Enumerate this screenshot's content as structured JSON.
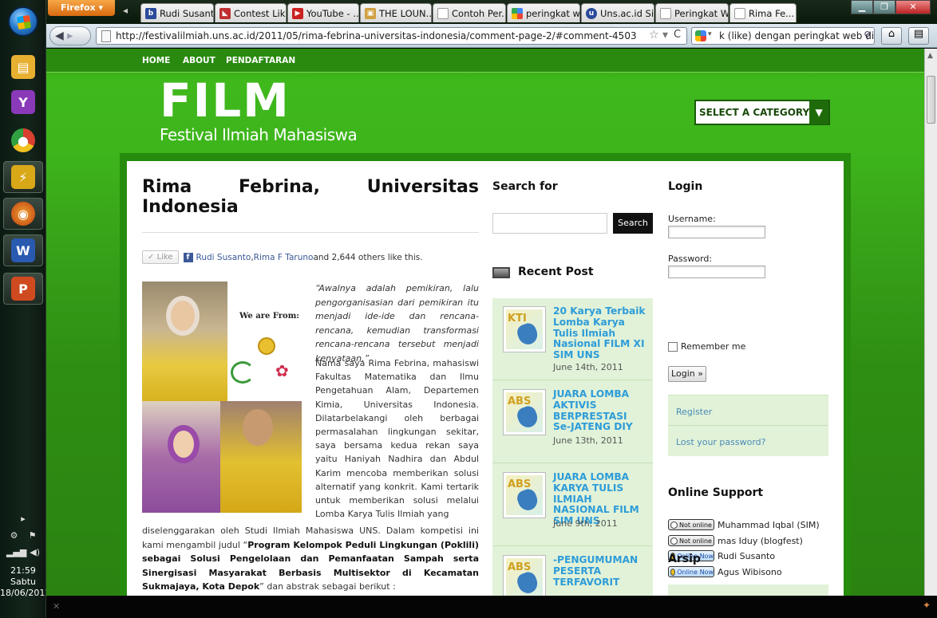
{
  "taskbar": {
    "items": [
      {
        "name": "explorer-icon",
        "color": "#e8b030"
      },
      {
        "name": "yahoo-messenger-icon",
        "color": "#8a3ab8"
      },
      {
        "name": "chrome-icon",
        "color": "#d84030"
      },
      {
        "name": "winamp-icon",
        "color": "#d8a818"
      },
      {
        "name": "firefox-icon",
        "color": "#e06a18"
      },
      {
        "name": "word-icon",
        "color": "#2a5ab0"
      },
      {
        "name": "powerpoint-icon",
        "color": "#d04a20"
      }
    ],
    "tray": {
      "time": "21:59",
      "day": "Sabtu",
      "date": "18/06/2011"
    }
  },
  "browser": {
    "firefox_menu": "Firefox",
    "tabs": [
      {
        "label": "Rudi Susanto",
        "icon": "blog-icon",
        "color": "#2a4a9a"
      },
      {
        "label": "Contest Lik...",
        "icon": "contest-icon",
        "color": "#c03030"
      },
      {
        "label": "YouTube - ...",
        "icon": "youtube-icon",
        "color": "#cc2020"
      },
      {
        "label": "THE LOUN...",
        "icon": "lounge-icon",
        "color": "#d0a040"
      },
      {
        "label": "Contoh Per...",
        "icon": "page-icon",
        "color": "#888888"
      },
      {
        "label": "peringkat w...",
        "icon": "google-icon",
        "color": "#4285f4"
      },
      {
        "label": "Uns.ac.id Sit...",
        "icon": "uns-icon",
        "color": "#2a4a9a"
      },
      {
        "label": "Peringkat W...",
        "icon": "page-icon",
        "color": "#888888"
      },
      {
        "label": "Rima Fe...",
        "icon": "page-icon",
        "color": "#888888",
        "active": true
      }
    ],
    "url": "http://festivalilmiah.uns.ac.id/2011/05/rima-febrina-universitas-indonesia/comment-page-2/#comment-4503",
    "search_text": "k (like) dengan peringkat web di alexa"
  },
  "site": {
    "nav": [
      "HOME",
      "ABOUT",
      "PENDAFTARAN"
    ],
    "logo_title": "FILM",
    "logo_subtitle": "Festival Ilmiah Mahasiswa",
    "category_select": "SELECT A CATEGORY"
  },
  "post": {
    "title_line1_words": [
      "Rima",
      "Febrina,",
      "Universitas"
    ],
    "title_line2": "Indonesia",
    "like": {
      "button": "Like",
      "friend1": "Rudi Susanto",
      "sep": ", ",
      "friend2": "Rima F Taruno",
      "others": " and 2,644 others like this."
    },
    "photo_caption": "We are From:",
    "quote": "“Awalnya adalah pemikiran, lalu pengorganisasian dari pemikiran itu menjadi ide-ide dan rencana-rencana, kemudian transformasi rencana-rencana tersebut menjadi kenyataan.”",
    "body1": "Nama saya Rima Febrina, mahasiswi Fakultas Matematika dan Ilmu Pengetahuan Alam, Departemen Kimia, Universitas Indonesia. Dilatarbelakangi oleh berbagai permasalahan lingkungan sekitar, saya bersama kedua rekan saya yaitu Haniyah Nadhira dan Abdul Karim mencoba memberikan solusi alternatif yang konkrit. Kami tertarik untuk memberikan solusi melalui Lomba Karya Tulis Ilmiah yang",
    "body2_pre": "diselenggarakan oleh Studi Ilmiah Mahasiswa UNS. Dalam kompetisi ini kami mengambil judul “",
    "body2_bold": "Program Kelompok Peduli Lingkungan (Poklili) sebagai Solusi Pengelolaan dan Pemanfaatan Sampah serta Sinergisasi Masyarakat Berbasis Multisektor di Kecamatan Sukmajaya, Kota Depok",
    "body2_post": "” dan abstrak sebagai berikut :"
  },
  "sidebar_mid": {
    "search_title": "Search for",
    "search_button": "Search",
    "recent_title": "Recent Post",
    "recent_posts": [
      {
        "thumb": "KTI",
        "title": "20 Karya Terbaik Lomba Karya Tulis Ilmiah Nasional FILM XI SIM UNS",
        "date": "June 14th, 2011"
      },
      {
        "thumb": "ABS",
        "title": "JUARA LOMBA AKTIVIS BERPRESTASI Se-JATENG DIY",
        "date": "June 13th, 2011"
      },
      {
        "thumb": "ABS",
        "title": "JUARA LOMBA KARYA TULIS ILMIAH NASIONAL FILM SIM UNS",
        "date": "June 9th, 2011"
      },
      {
        "thumb": "ABS",
        "title": "-PENGUMUMAN PESERTA TERFAVORIT",
        "date": ""
      }
    ]
  },
  "sidebar_right": {
    "login_title": "Login",
    "username_label": "Username:",
    "password_label": "Password:",
    "remember_label": "Remember me",
    "login_button": "Login »",
    "register_link": "Register",
    "lost_password_link": "Lost your password?",
    "support_title": "Online Support",
    "support": [
      {
        "status": "Not online",
        "name": "Muhammad Iqbal (SIM)",
        "online": false
      },
      {
        "status": "Not online",
        "name": "mas Iduy (blogfest)",
        "online": false
      },
      {
        "status": "Online Now",
        "name": "Rudi Susanto",
        "online": true
      },
      {
        "status": "Online Now",
        "name": "Agus Wibisono",
        "online": true
      }
    ],
    "archive_title": "Arsip"
  }
}
